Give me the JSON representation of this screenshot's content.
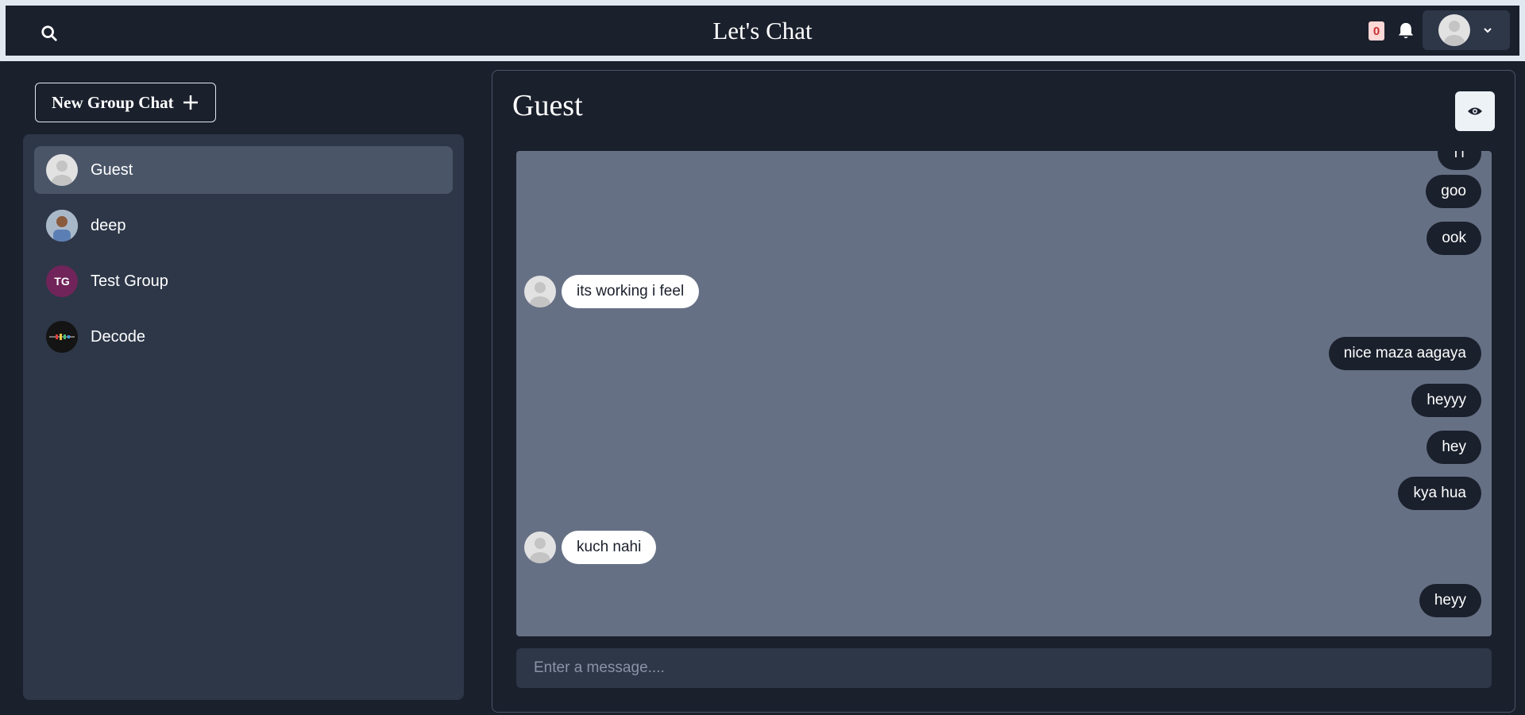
{
  "header": {
    "title": "Let's Chat",
    "notification_count": "0"
  },
  "sidebar": {
    "new_group_label": "New Group Chat",
    "chats": [
      {
        "name": "Guest",
        "avatar": "default-avatar",
        "active": true
      },
      {
        "name": "deep",
        "avatar": "photo-avatar",
        "active": false
      },
      {
        "name": "Test Group",
        "avatar_text": "TG",
        "active": false
      },
      {
        "name": "Decode",
        "avatar": "image-avatar",
        "active": false
      }
    ]
  },
  "chat": {
    "title": "Guest",
    "messages": [
      {
        "text": "тт",
        "side": "sent"
      },
      {
        "text": "goo",
        "side": "sent"
      },
      {
        "text": "ook",
        "side": "sent"
      },
      {
        "text": "its working i feel",
        "side": "received"
      },
      {
        "text": "nice maza aagaya",
        "side": "sent"
      },
      {
        "text": "heyyy",
        "side": "sent"
      },
      {
        "text": "hey",
        "side": "sent"
      },
      {
        "text": "kya hua",
        "side": "sent"
      },
      {
        "text": "kuch nahi",
        "side": "received"
      },
      {
        "text": "heyy",
        "side": "sent"
      }
    ],
    "input_placeholder": "Enter a message...."
  },
  "colors": {
    "background": "#1a202c",
    "panel": "#2d3748",
    "active_item": "#4a5568",
    "message_area": "#667085",
    "sent_bubble": "#1a202c",
    "received_bubble": "#ffffff",
    "test_group_avatar": "#702459"
  },
  "icons": [
    "search-icon",
    "bell-icon",
    "chevron-down-icon",
    "plus-icon",
    "eye-icon",
    "user-avatar-icon"
  ]
}
